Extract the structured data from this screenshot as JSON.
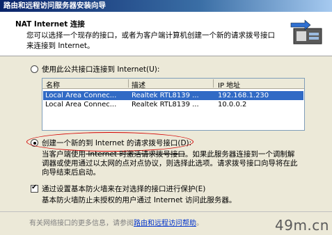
{
  "window": {
    "title": "路由和远程访问服务器安装向导"
  },
  "header": {
    "title": "NAT Internet 连接",
    "description": "您可以选择一个现存的接口，或者为客户端计算机创建一个新的请求拨号接口来连接到 Internet。",
    "icon": "network-wizard-icon"
  },
  "option_existing": {
    "label": "使用此公共接口连接到 Internet(U):",
    "selected": false
  },
  "interface_list": {
    "columns": [
      "名称",
      "描述",
      "IP 地址"
    ],
    "rows": [
      {
        "name": "Local Area Connec...",
        "description": "Realtek RTL8139 ...",
        "ip": "192.168.1.230",
        "selected": true
      },
      {
        "name": "Local Area Connec...",
        "description": "Realtek RTL8139 ...",
        "ip": "10.0.0.2",
        "selected": false
      }
    ]
  },
  "option_new": {
    "label": "创建一个新的到 Internet 的请求拨号接口(D):",
    "selected": true,
    "description_before": "当客户端使用",
    "description_struck": " Internet 时激活请求拨号接口",
    "description_after": "。如果此服务器连接到一个调制解调器或使用通过以太网的点对点协议，则选择此选项。请求拨号接口向导将在此向导结束后启动。"
  },
  "firewall": {
    "label": "通过设置基本防火墙来在对选择的接口进行保护(E)",
    "description": "基本防火墙防止未授权的用户通过 Internet 访问此服务器。",
    "checked": true
  },
  "footer": {
    "text": "有关网络接口的更多信息，请参阅",
    "link": "路由和远程访问帮助",
    "suffix": "。"
  },
  "watermark": "49m.cn",
  "colors": {
    "title_bar": "#0a246a",
    "selection": "#316ac5",
    "highlight_ellipse": "#d40000",
    "link": "#0033cc"
  }
}
